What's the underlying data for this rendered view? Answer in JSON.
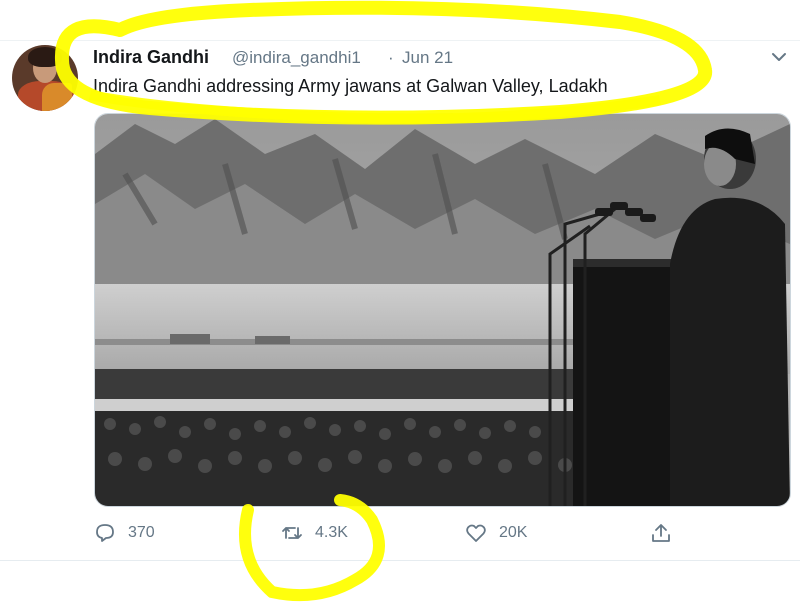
{
  "tweet": {
    "author_name": "Indira Gandhi",
    "handle": "@indira_gandhi1",
    "separator": "·",
    "date": "Jun 21",
    "text": "Indira Gandhi addressing Army jawans at Galwan Valley, Ladakh",
    "photo_description_icon": "black-and-white-photo"
  },
  "actions": {
    "reply_count": "370",
    "retweet_count": "4.3K",
    "like_count": "20K"
  },
  "icons": {
    "reply": "reply-icon",
    "retweet": "retweet-icon",
    "like": "heart-icon",
    "share": "share-icon",
    "more": "chevron-down-icon"
  },
  "colors": {
    "text": "#14171a",
    "secondary": "#657786",
    "highlight": "#ffff00"
  }
}
